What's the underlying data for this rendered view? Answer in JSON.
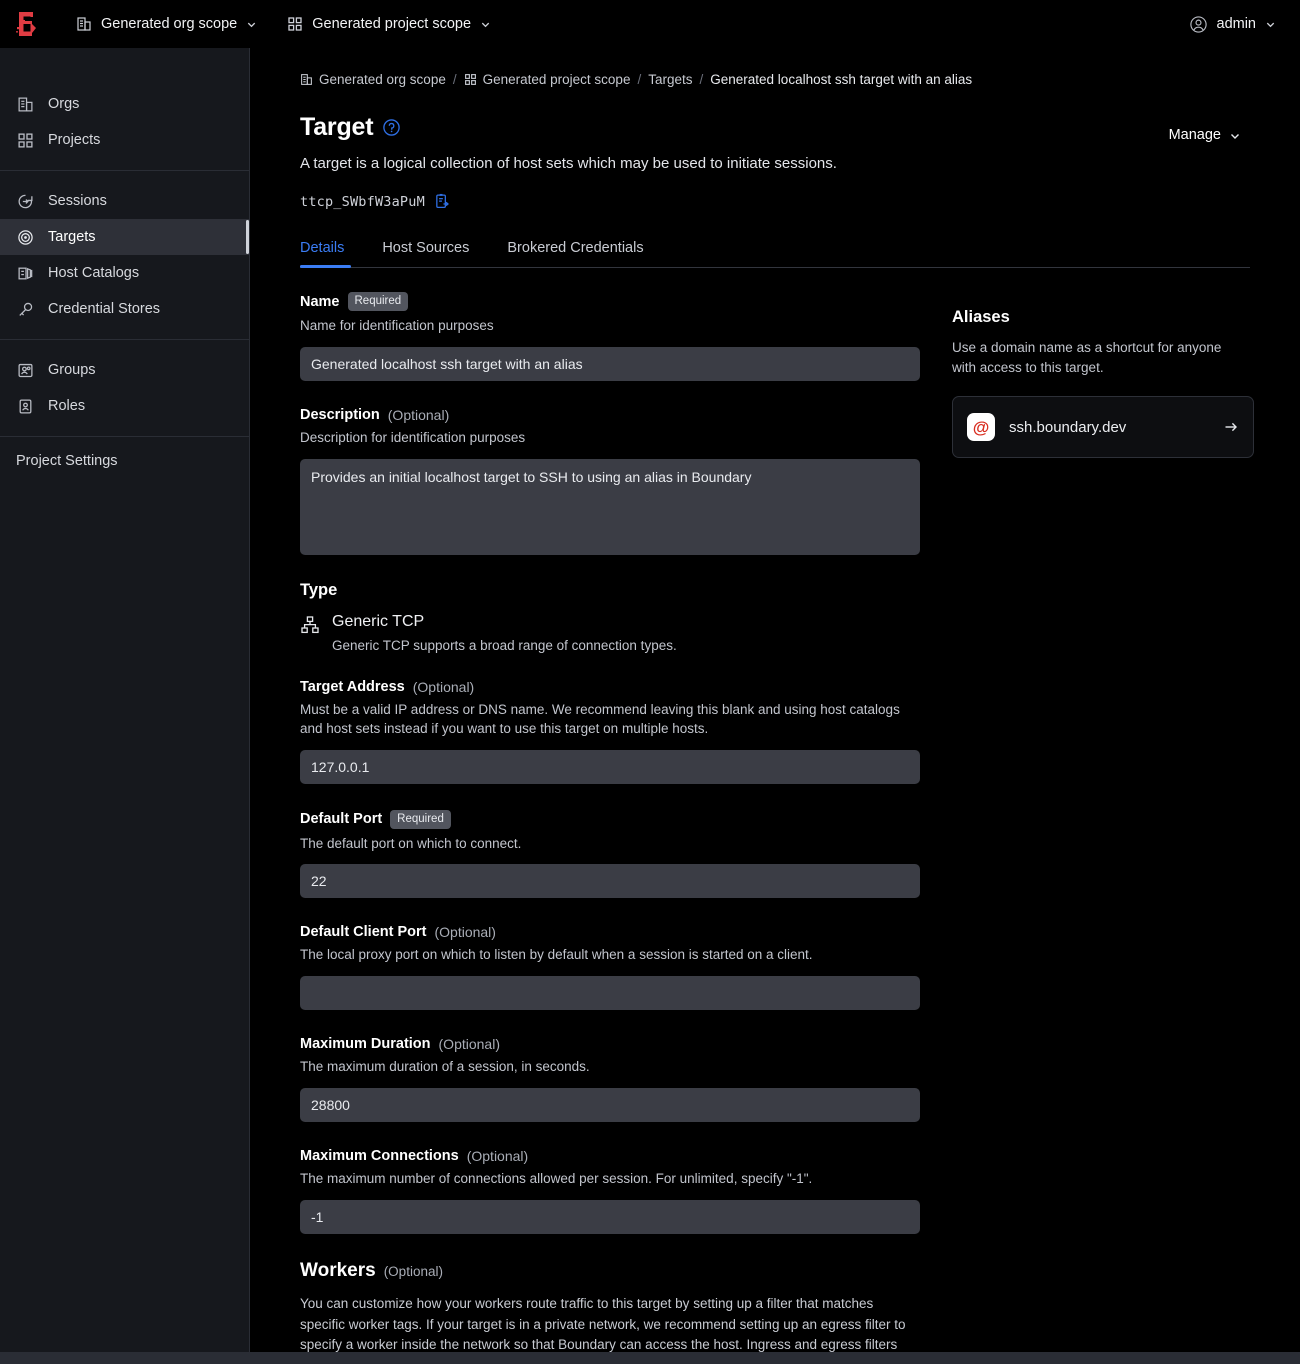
{
  "topbar": {
    "logo_name": "boundary-logo",
    "org_scope": "Generated org scope",
    "project_scope": "Generated project scope",
    "user": "admin"
  },
  "sidebar": {
    "groups": [
      {
        "items": [
          {
            "label": "Orgs",
            "icon": "building-icon",
            "active": false
          },
          {
            "label": "Projects",
            "icon": "grid-icon",
            "active": false
          }
        ]
      },
      {
        "items": [
          {
            "label": "Sessions",
            "icon": "login-arrow-icon",
            "active": false
          },
          {
            "label": "Targets",
            "icon": "target-icon",
            "active": true
          },
          {
            "label": "Host Catalogs",
            "icon": "host-catalog-icon",
            "active": false
          },
          {
            "label": "Credential Stores",
            "icon": "key-icon",
            "active": false
          }
        ]
      },
      {
        "items": [
          {
            "label": "Groups",
            "icon": "groups-icon",
            "active": false
          },
          {
            "label": "Roles",
            "icon": "roles-icon",
            "active": false
          }
        ]
      }
    ],
    "footer_item": "Project Settings"
  },
  "breadcrumb": [
    {
      "label": "Generated org scope",
      "icon": "building-icon"
    },
    {
      "label": "Generated project scope",
      "icon": "grid-icon"
    },
    {
      "label": "Targets",
      "icon": ""
    },
    {
      "label": "Generated localhost ssh target with an alias",
      "icon": ""
    }
  ],
  "header": {
    "title": "Target",
    "help_icon": "question-circle-icon",
    "subtitle": "A target is a logical collection of host sets which may be used to initiate sessions.",
    "manage_label": "Manage",
    "resource_id": "ttcp_SWbfW3aPuM",
    "copy_icon": "copy-clipboard-icon"
  },
  "tabs": [
    {
      "label": "Details",
      "active": true
    },
    {
      "label": "Host Sources",
      "active": false
    },
    {
      "label": "Brokered Credentials",
      "active": false
    }
  ],
  "form": {
    "name": {
      "label": "Name",
      "badge": "Required",
      "help": "Name for identification purposes",
      "value": "Generated localhost ssh target with an alias"
    },
    "description": {
      "label": "Description",
      "optional": "(Optional)",
      "help": "Description for identification purposes",
      "value": "Provides an initial localhost target to SSH to using an alias in Boundary"
    },
    "type": {
      "heading": "Type",
      "icon": "sitemap-icon",
      "name": "Generic TCP",
      "desc": "Generic TCP supports a broad range of connection types."
    },
    "target_address": {
      "label": "Target Address",
      "optional": "(Optional)",
      "help": "Must be a valid IP address or DNS name. We recommend leaving this blank and using host catalogs and host sets instead if you want to use this target on multiple hosts.",
      "value": "127.0.0.1"
    },
    "default_port": {
      "label": "Default Port",
      "badge": "Required",
      "help": "The default port on which to connect.",
      "value": "22"
    },
    "default_client_port": {
      "label": "Default Client Port",
      "optional": "(Optional)",
      "help": "The local proxy port on which to listen by default when a session is started on a client.",
      "value": ""
    },
    "maximum_duration": {
      "label": "Maximum Duration",
      "optional": "(Optional)",
      "help": "The maximum duration of a session, in seconds.",
      "value": "28800"
    },
    "maximum_connections": {
      "label": "Maximum Connections",
      "optional": "(Optional)",
      "help": "The maximum number of connections allowed per session. For unlimited, specify \"-1\".",
      "value": "-1"
    },
    "workers": {
      "heading": "Workers",
      "optional": "(Optional)",
      "paragraph": "You can customize how your workers route traffic to this target by setting up a filter that matches specific worker tags. If your target is in a private network, we recommend setting up an egress filter to specify a worker inside the network so that Boundary can access the host. Ingress and egress filters"
    }
  },
  "aliases": {
    "heading": "Aliases",
    "description": "Use a domain name as a shortcut for anyone with access to this target.",
    "items": [
      {
        "name": "ssh.boundary.dev",
        "badge_glyph": "@",
        "arrow_icon": "arrow-right-icon"
      }
    ]
  },
  "colors": {
    "accent_blue": "#3b7df5",
    "brand_red": "#e03c43",
    "alias_red": "#d92d20",
    "sidebar_bg": "#16181d",
    "input_bg": "#3b3d45",
    "page_bg": "#000000"
  }
}
